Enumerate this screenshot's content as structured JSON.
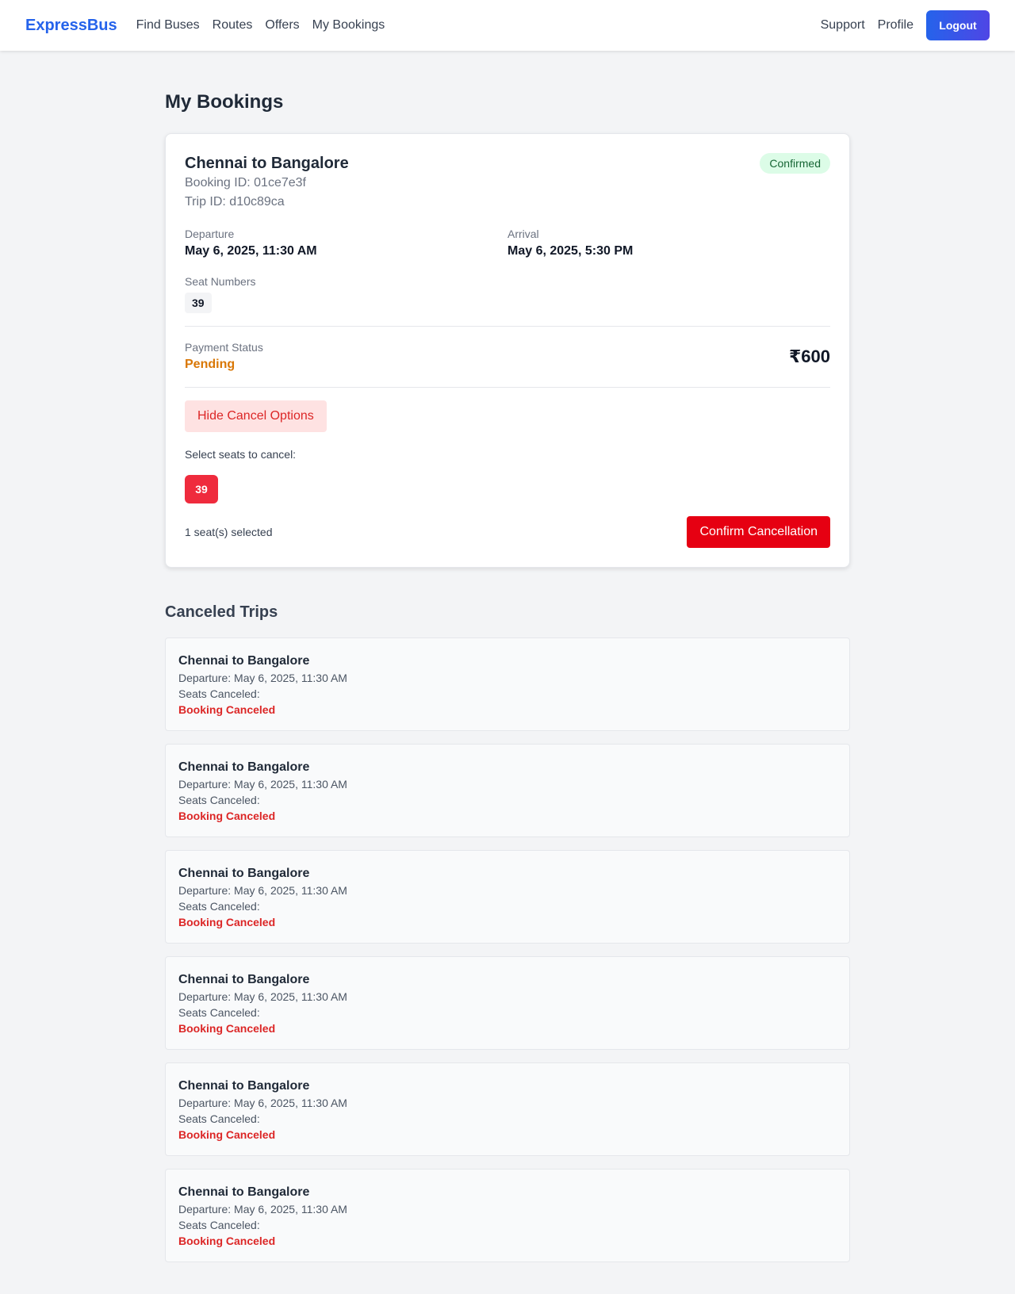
{
  "nav": {
    "brand": "ExpressBus",
    "links": [
      "Find Buses",
      "Routes",
      "Offers",
      "My Bookings"
    ],
    "support": "Support",
    "profile": "Profile",
    "logout": "Logout",
    "brand_color": "#2563eb"
  },
  "page": {
    "title": "My Bookings"
  },
  "booking": {
    "route": "Chennai to Bangalore",
    "booking_id": "Booking ID: 01ce7e3f",
    "trip_id": "Trip ID: d10c89ca",
    "status": "Confirmed",
    "departure_label": "Departure",
    "departure_value": "May 6, 2025, 11:30 AM",
    "arrival_label": "Arrival",
    "arrival_value": "May 6, 2025, 5:30 PM",
    "seats_label": "Seat Numbers",
    "seat": "39",
    "payment_label": "Payment Status",
    "payment_status": "Pending",
    "price": "₹600",
    "hide_cancel": "Hide Cancel Options",
    "select_label": "Select seats to cancel:",
    "cancel_seat": "39",
    "selected_count": "1 seat(s) selected",
    "confirm": "Confirm Cancellation"
  },
  "canceled": {
    "title": "Canceled Trips",
    "trips": [
      {
        "route": "Chennai to Bangalore",
        "departure": "Departure: May 6, 2025, 11:30 AM",
        "seats": "Seats Canceled:",
        "status": "Booking Canceled"
      },
      {
        "route": "Chennai to Bangalore",
        "departure": "Departure: May 6, 2025, 11:30 AM",
        "seats": "Seats Canceled:",
        "status": "Booking Canceled"
      },
      {
        "route": "Chennai to Bangalore",
        "departure": "Departure: May 6, 2025, 11:30 AM",
        "seats": "Seats Canceled:",
        "status": "Booking Canceled"
      },
      {
        "route": "Chennai to Bangalore",
        "departure": "Departure: May 6, 2025, 11:30 AM",
        "seats": "Seats Canceled:",
        "status": "Booking Canceled"
      },
      {
        "route": "Chennai to Bangalore",
        "departure": "Departure: May 6, 2025, 11:30 AM",
        "seats": "Seats Canceled:",
        "status": "Booking Canceled"
      },
      {
        "route": "Chennai to Bangalore",
        "departure": "Departure: May 6, 2025, 11:30 AM",
        "seats": "Seats Canceled:",
        "status": "Booking Canceled"
      }
    ]
  }
}
